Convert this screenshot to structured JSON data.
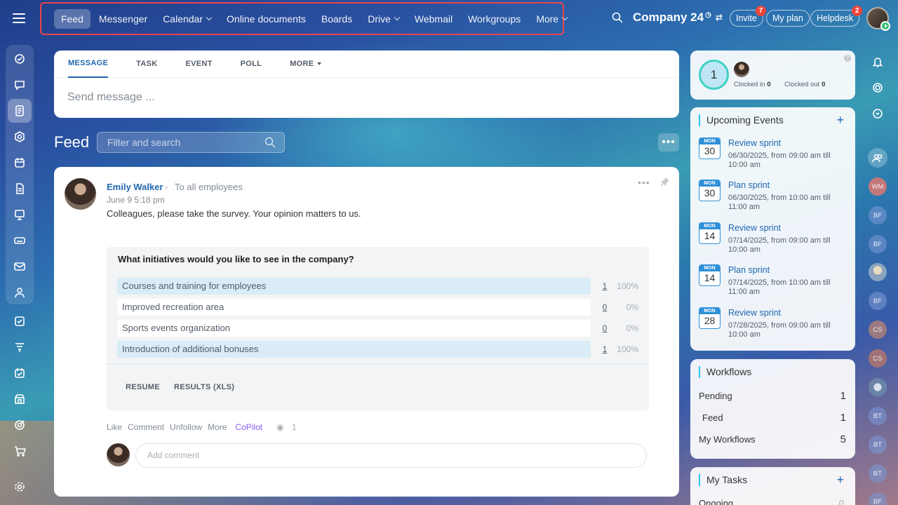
{
  "topbar": {
    "nav": [
      {
        "label": "Feed",
        "active": true,
        "dropdown": false
      },
      {
        "label": "Messenger",
        "active": false,
        "dropdown": false
      },
      {
        "label": "Calendar",
        "active": false,
        "dropdown": true
      },
      {
        "label": "Online documents",
        "active": false,
        "dropdown": false
      },
      {
        "label": "Boards",
        "active": false,
        "dropdown": false
      },
      {
        "label": "Drive",
        "active": false,
        "dropdown": true
      },
      {
        "label": "Webmail",
        "active": false,
        "dropdown": false
      },
      {
        "label": "Workgroups",
        "active": false,
        "dropdown": false
      },
      {
        "label": "More",
        "active": false,
        "dropdown": true
      }
    ],
    "company": "Company 24",
    "invite": {
      "label": "Invite",
      "badge": "7"
    },
    "my_plan": "My plan",
    "helpdesk": {
      "label": "Helpdesk",
      "badge": "2"
    }
  },
  "composer": {
    "tabs": [
      "MESSAGE",
      "TASK",
      "EVENT",
      "POLL",
      "MORE"
    ],
    "placeholder": "Send message ..."
  },
  "feed": {
    "title": "Feed",
    "filter_placeholder": "Filter and search"
  },
  "post": {
    "author": "Emily Walker",
    "target": "To all employees",
    "date": "June 9 5:18 pm",
    "text": "Colleagues, please take the survey. Your opinion matters to us.",
    "poll": {
      "question": "What initiatives would you like to see in the company?",
      "options": [
        {
          "label": "Courses and training for employees",
          "count": "1",
          "percent": "100%"
        },
        {
          "label": "Improved recreation area",
          "count": "0",
          "percent": "0%"
        },
        {
          "label": "Sports events organization",
          "count": "0",
          "percent": "0%"
        },
        {
          "label": "Introduction of additional bonuses",
          "count": "1",
          "percent": "100%"
        }
      ],
      "resume": "RESUME",
      "results": "RESULTS (XLS)"
    },
    "actions": [
      "Like",
      "Comment",
      "Unfollow",
      "More"
    ],
    "copilot": "CoPilot",
    "views": "1",
    "comment_placeholder": "Add comment"
  },
  "timeman": {
    "count": "1",
    "clocked_in_label": "Clocked in",
    "clocked_in": "0",
    "clocked_out_label": "Clocked out",
    "clocked_out": "0"
  },
  "events": {
    "title": "Upcoming Events",
    "items": [
      {
        "month": "MON",
        "day": "30",
        "title": "Review sprint",
        "when": "06/30/2025, from 09:00 am till 10:00 am"
      },
      {
        "month": "MON",
        "day": "30",
        "title": "Plan sprint",
        "when": "06/30/2025, from 10:00 am till 11:00 am"
      },
      {
        "month": "MON",
        "day": "14",
        "title": "Review sprint",
        "when": "07/14/2025, from 09:00 am till 10:00 am"
      },
      {
        "month": "MON",
        "day": "14",
        "title": "Plan sprint",
        "when": "07/14/2025, from 10:00 am till 11:00 am"
      },
      {
        "month": "MON",
        "day": "28",
        "title": "Review sprint",
        "when": "07/28/2025, from 09:00 am till 10:00 am"
      }
    ]
  },
  "workflows": {
    "title": "Workflows",
    "rows": [
      {
        "label": "Pending",
        "count": "1"
      },
      {
        "label": "Feed",
        "count": "1"
      },
      {
        "label": "My Workflows",
        "count": "5"
      }
    ]
  },
  "tasks": {
    "title": "My Tasks",
    "ongoing_label": "Ongoing",
    "ongoing": "0"
  },
  "rail": {
    "avatars": [
      "WM",
      "BF",
      "BF",
      "",
      "BF",
      "CS",
      "CS",
      "",
      "BT",
      "BT",
      "BT",
      "BF"
    ]
  }
}
